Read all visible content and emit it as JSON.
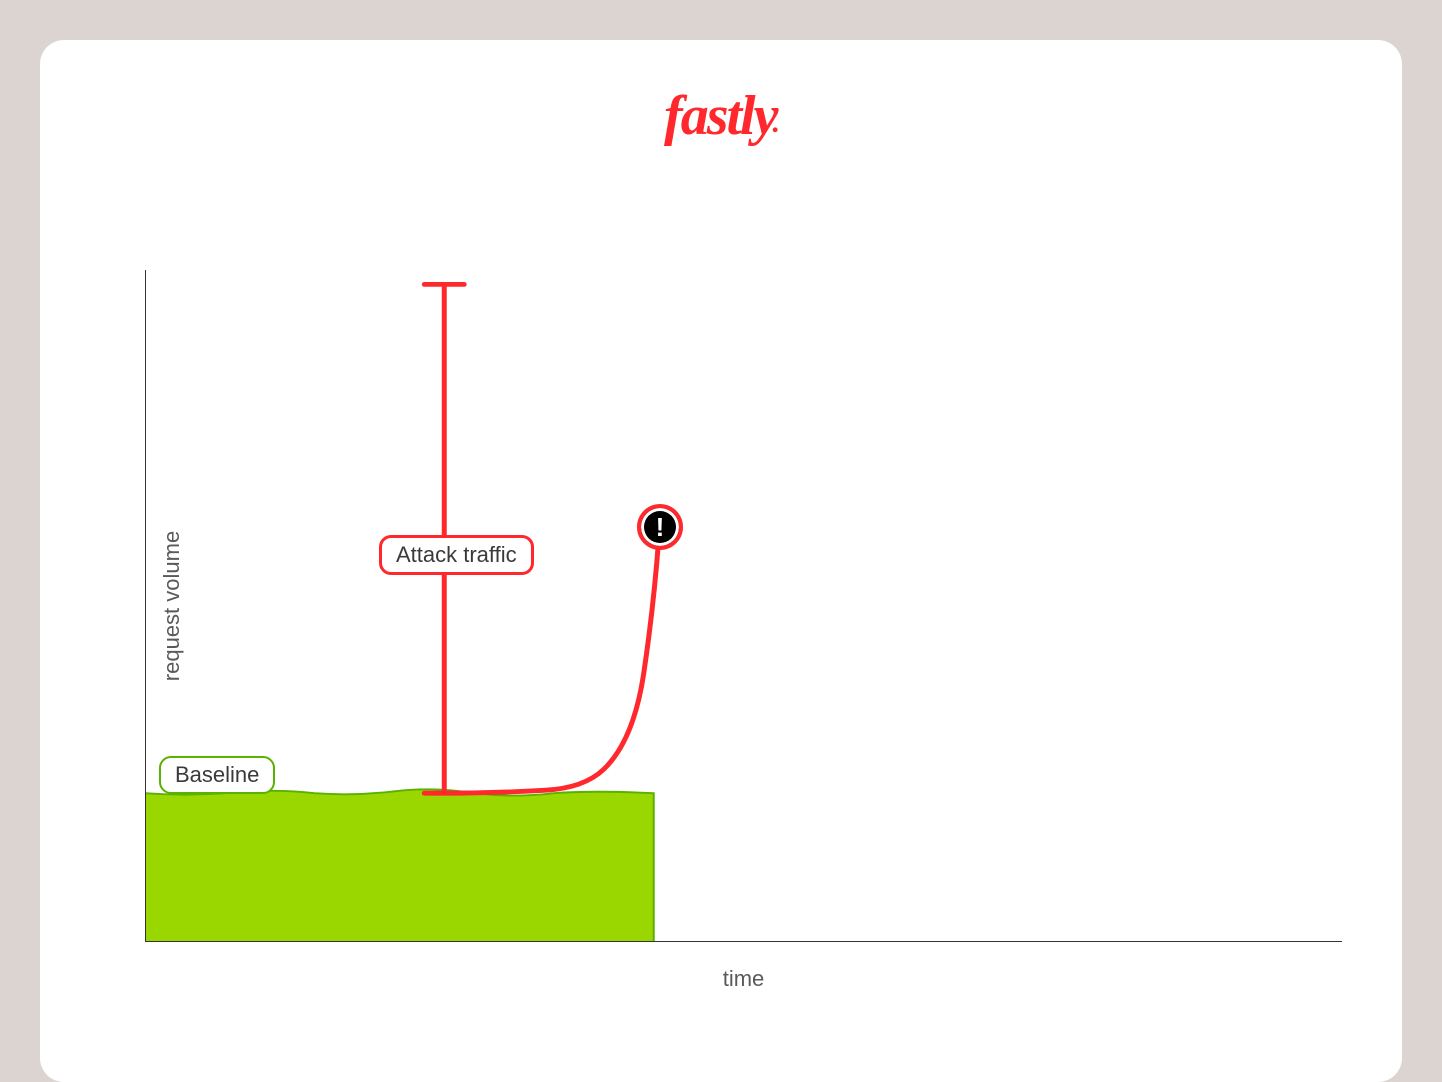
{
  "brand": {
    "name": "fastly"
  },
  "chart_data": {
    "type": "area",
    "title": "",
    "xlabel": "time",
    "ylabel": "request volume",
    "x_range": [
      0,
      100
    ],
    "y_range": [
      0,
      100
    ],
    "series": [
      {
        "name": "Baseline",
        "color": "#9ad600",
        "x": [
          0,
          5,
          10,
          15,
          20,
          25,
          30,
          35,
          40,
          42
        ],
        "y": [
          22,
          21.5,
          22.5,
          22,
          23,
          22.5,
          22,
          22,
          22,
          22
        ]
      },
      {
        "name": "Attack traffic",
        "color": "#ff282d",
        "x": [
          25,
          30,
          35,
          38,
          40,
          41,
          42,
          43
        ],
        "y": [
          22,
          22,
          22,
          23,
          27,
          35,
          48,
          62
        ]
      }
    ],
    "annotations": [
      {
        "type": "range-bracket",
        "series": "Attack traffic",
        "x": 25,
        "y_from": 22,
        "y_to": 100,
        "label": "Attack traffic"
      },
      {
        "type": "alert-marker",
        "x": 43,
        "y": 62,
        "icon": "exclamation"
      }
    ],
    "labels": {
      "baseline": "Baseline",
      "attack": "Attack traffic"
    }
  }
}
